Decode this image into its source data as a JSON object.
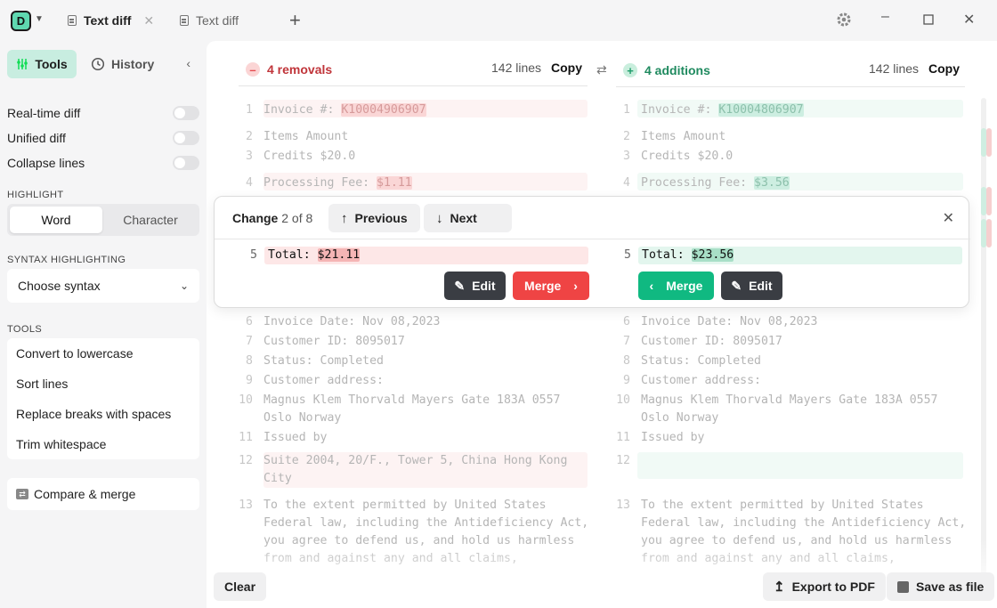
{
  "app": {
    "logo_letter": "D",
    "tabs": [
      {
        "label": "Text diff",
        "active": true
      },
      {
        "label": "Text diff",
        "active": false
      }
    ]
  },
  "sidebar": {
    "tools_label": "Tools",
    "history_label": "History",
    "toggles": [
      {
        "label": "Real-time diff",
        "on": false
      },
      {
        "label": "Unified diff",
        "on": false
      },
      {
        "label": "Collapse lines",
        "on": false
      }
    ],
    "highlight_label": "HIGHLIGHT",
    "highlight_options": [
      "Word",
      "Character"
    ],
    "highlight_selected": "Word",
    "syntax_label": "SYNTAX HIGHLIGHTING",
    "syntax_value": "Choose syntax",
    "tools_section_label": "TOOLS",
    "tools": [
      "Convert to lowercase",
      "Sort lines",
      "Replace breaks with spaces",
      "Trim whitespace"
    ],
    "compare_label": "Compare & merge"
  },
  "left_pane": {
    "title": "4 removals",
    "line_count": "142 lines",
    "copy_label": "Copy",
    "color": "#e5484d"
  },
  "right_pane": {
    "title": "4 additions",
    "line_count": "142 lines",
    "copy_label": "Copy",
    "color": "#1f9d6b"
  },
  "lines": {
    "l1": {
      "num": "1",
      "prefix": "Invoice #: ",
      "left_hl": "K10004906907",
      "right_hl": "K10004806907"
    },
    "l2": {
      "num": "2",
      "text": "Items Amount"
    },
    "l3": {
      "num": "3",
      "text": "Credits $20.0"
    },
    "l4": {
      "num": "4",
      "prefix": "Processing Fee: ",
      "left_hl": "$1.11",
      "right_hl": "$3.56"
    },
    "l6": {
      "num": "6",
      "text": "Invoice Date: Nov 08,2023"
    },
    "l7": {
      "num": "7",
      "text": "Customer ID: 8095017"
    },
    "l8": {
      "num": "8",
      "text": "Status: Completed"
    },
    "l9": {
      "num": "9",
      "text": "Customer address:"
    },
    "l10": {
      "num": "10",
      "text": "Magnus Klem Thorvald Mayers Gate 183A 0557",
      "text2": "Oslo Norway"
    },
    "l11": {
      "num": "11",
      "text": "Issued by"
    },
    "l12": {
      "num": "12",
      "left_text": "Suite 2004, 20/F., Tower 5, China Hong Kong",
      "left_text2": "City"
    },
    "l13": {
      "num": "13",
      "text": "To the extent permitted by United States",
      "text2": "Federal law, including the Antideficiency Act,",
      "text3": "you agree to defend us, and hold us harmless",
      "text4": "from and against any and all claims,"
    }
  },
  "change": {
    "label": "Change",
    "index": "2",
    "of_total": "of 8",
    "prev_label": "Previous",
    "next_label": "Next",
    "line_num": "5",
    "prefix": "Total: ",
    "left_value": "$21.11",
    "right_value": "$23.56",
    "edit_label": "Edit",
    "merge_label": "Merge"
  },
  "footer": {
    "clear_label": "Clear",
    "export_label": "Export to PDF",
    "save_label": "Save as file"
  }
}
